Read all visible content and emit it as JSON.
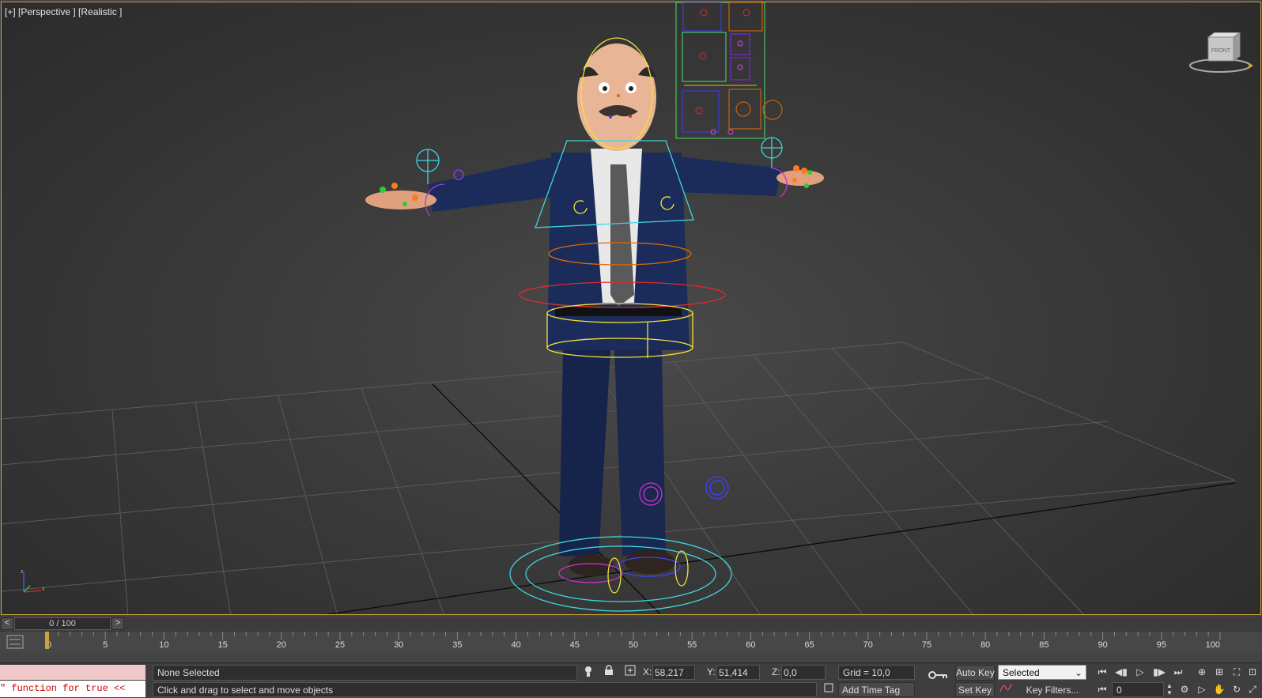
{
  "viewport": {
    "label": "[+] [Perspective ] [Realistic ]",
    "viewcube_face": "FRONT"
  },
  "timeline": {
    "prev_label": "<",
    "next_label": ">",
    "slider_text": "0 / 100"
  },
  "trackbar": {
    "frame_labels": [
      "0",
      "5",
      "10",
      "15",
      "20",
      "25",
      "30",
      "35",
      "40",
      "45",
      "50",
      "55",
      "60",
      "65",
      "70",
      "75",
      "80",
      "85",
      "90",
      "95",
      "100"
    ]
  },
  "status": {
    "maxscript_output": "\" function for true <<",
    "selection": "None Selected",
    "prompt": "Click and drag to select and move objects",
    "x_label": "X:",
    "x_value": "58,217",
    "y_label": "Y:",
    "y_value": "51,414",
    "z_label": "Z:",
    "z_value": "0,0",
    "grid": "Grid = 10,0",
    "add_time_tag": "Add Time Tag",
    "auto_key": "Auto Key",
    "set_key": "Set Key",
    "selected_dropdown": "Selected",
    "key_filters": "Key Filters...",
    "current_frame": "0"
  },
  "icons": [
    "lock-icon",
    "key-icon",
    "play-icon",
    "pan-icon",
    "orbit-icon",
    "zoom-icon"
  ],
  "colors": {
    "viewport_border": "#c8a23a",
    "maxscript_error": "#cc0000",
    "listener_bg": "#f0c8c8"
  }
}
